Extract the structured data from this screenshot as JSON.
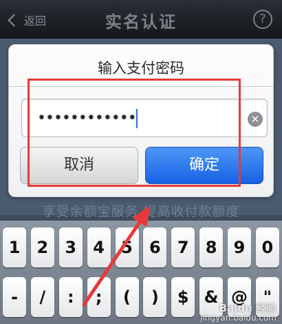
{
  "navbar": {
    "back_label": "返回",
    "title": "实名认证",
    "help_icon": "?"
  },
  "promo_text": "享受余额宝服务,提高收付款额度",
  "dialog": {
    "title": "输入支付密码",
    "password_mask": "••••••••••••",
    "clear_icon": "✕",
    "cancel_label": "取消",
    "confirm_label": "确定"
  },
  "keyboard": {
    "row1": [
      "1",
      "2",
      "3",
      "4",
      "5",
      "6",
      "7",
      "8",
      "9",
      "0"
    ],
    "row2": [
      "-",
      "/",
      ":",
      ";",
      "(",
      ")",
      "$",
      "&",
      "@",
      "\""
    ]
  },
  "watermark": {
    "main": "Baidu 经验",
    "sub": "jingyan.baidu.com"
  },
  "colors": {
    "highlight": "#e63a3a",
    "confirm_button": "#2a73ee",
    "navbar": "#1c1f24"
  }
}
